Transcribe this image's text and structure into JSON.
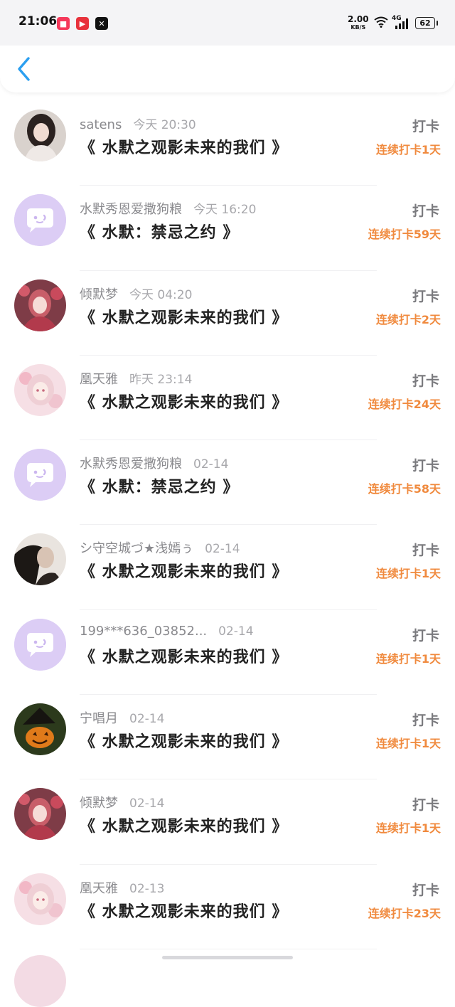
{
  "status_bar": {
    "time": "21:06",
    "net_speed": "2.00",
    "net_unit": "KB/S",
    "network": "4G",
    "battery": "62"
  },
  "header": {
    "back_icon": "chevron-left-icon"
  },
  "colors": {
    "accent": "#2b9ff0",
    "streak": "#f08a3e",
    "default_avatar": "#dccdf5"
  },
  "records": [
    {
      "name": "satens",
      "time": "今天 20:30",
      "title": "《 水默之观影未来的我们 》",
      "action": "打卡",
      "streak": "连续打卡1天",
      "avatar": "girl-photo"
    },
    {
      "name": "水默秀恩爱撒狗粮",
      "time": "今天 16:20",
      "title": "《 水默：禁忌之约 》",
      "action": "打卡",
      "streak": "连续打卡59天",
      "avatar": "default-chat"
    },
    {
      "name": "倾默梦",
      "time": "今天 04:20",
      "title": "《 水默之观影未来的我们 》",
      "action": "打卡",
      "streak": "连续打卡2天",
      "avatar": "anime-red"
    },
    {
      "name": "凰天雅",
      "time": "昨天 23:14",
      "title": "《 水默之观影未来的我们 》",
      "action": "打卡",
      "streak": "连续打卡24天",
      "avatar": "anime-pink"
    },
    {
      "name": "水默秀恩爱撒狗粮",
      "time": "02-14",
      "title": "《 水默：禁忌之约 》",
      "action": "打卡",
      "streak": "连续打卡58天",
      "avatar": "default-chat"
    },
    {
      "name": "シ守空城づ★浅嫣ぅ",
      "time": "02-14",
      "title": "《 水默之观影未来的我们 》",
      "action": "打卡",
      "streak": "连续打卡1天",
      "avatar": "girl-dark"
    },
    {
      "name": "199***636_03852...",
      "time": "02-14",
      "title": "《 水默之观影未来的我们 》",
      "action": "打卡",
      "streak": "连续打卡1天",
      "avatar": "default-chat"
    },
    {
      "name": "宁唱月",
      "time": "02-14",
      "title": "《 水默之观影未来的我们 》",
      "action": "打卡",
      "streak": "连续打卡1天",
      "avatar": "pumpkin"
    },
    {
      "name": "倾默梦",
      "time": "02-14",
      "title": "《 水默之观影未来的我们 》",
      "action": "打卡",
      "streak": "连续打卡1天",
      "avatar": "anime-red"
    },
    {
      "name": "凰天雅",
      "time": "02-13",
      "title": "《 水默之观影未来的我们 》",
      "action": "打卡",
      "streak": "连续打卡23天",
      "avatar": "anime-pink"
    }
  ]
}
